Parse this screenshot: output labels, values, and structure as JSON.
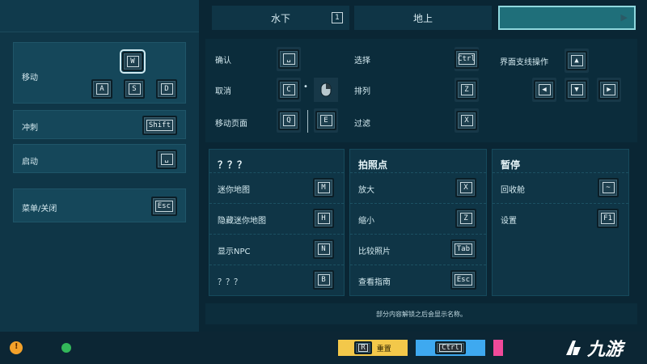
{
  "left": {
    "items": [
      {
        "label": "移动",
        "keys": [
          "W",
          "A",
          "S",
          "D"
        ]
      },
      {
        "label": "冲刺",
        "key": "Shift"
      },
      {
        "label": "启动",
        "key": "␣"
      },
      {
        "label": "菜单/关闭",
        "key": "Esc"
      }
    ]
  },
  "tabs": [
    {
      "label": "水下",
      "num": "1"
    },
    {
      "label": "地上"
    },
    {
      "label": ""
    }
  ],
  "controls": {
    "confirm": {
      "label": "确认",
      "key": "␣"
    },
    "cancel": {
      "label": "取消",
      "key": "C",
      "sep": "•"
    },
    "move_page": {
      "label": "移动页面",
      "key1": "Q",
      "key2": "E"
    },
    "select": {
      "label": "选择",
      "key": "Ctrl"
    },
    "sort": {
      "label": "排列",
      "key": "Z"
    },
    "filter": {
      "label": "过滤",
      "key": "X"
    },
    "ui_ops": {
      "label": "界面支线操作",
      "up": "▲",
      "left": "◀",
      "down": "▼",
      "right": "▶"
    }
  },
  "sections": {
    "unknown": {
      "title": "？？？",
      "rows": [
        {
          "label": "迷你地图",
          "key": "M"
        },
        {
          "label": "隐藏迷你地图",
          "key": "H"
        },
        {
          "label": "显示NPC",
          "key": "N"
        },
        {
          "label": "？？？",
          "key": "B"
        }
      ]
    },
    "photo": {
      "title": "拍照点",
      "rows": [
        {
          "label": "放大",
          "key": "X"
        },
        {
          "label": "缩小",
          "key": "Z"
        },
        {
          "label": "比较照片",
          "key": "Tab"
        },
        {
          "label": "查看指南",
          "key": "Esc"
        }
      ]
    },
    "pause": {
      "title": "暂停",
      "rows": [
        {
          "label": "回收舱",
          "key": "~"
        },
        {
          "label": "设置",
          "key": "F1"
        }
      ]
    }
  },
  "note": "部分内容解锁之后会显示名称。",
  "bottom": {
    "reset_label": "重置",
    "reset_key": "R",
    "ctrl_key": "Ctrl",
    "watermark": "九游"
  },
  "colors": {
    "yellow": "#f3c84a",
    "blue": "#3ea9f0",
    "pink": "#f04a9a",
    "accent": "#5fd0e0"
  }
}
